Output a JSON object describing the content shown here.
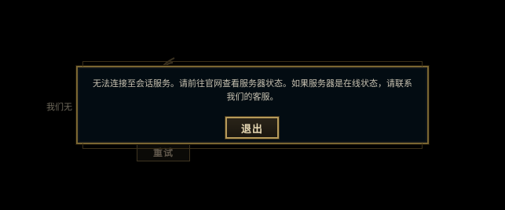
{
  "background": {
    "partial_text": "我们无",
    "retry_button_label": "重试"
  },
  "dialog": {
    "message": "无法连接至会话服务。请前往官网查看服务器状态。如果服务器是在线状态，请联系我们的客服。",
    "exit_button_label": "退出"
  },
  "colors": {
    "dialog_border": "#7a6632",
    "dialog_background": "#030c12",
    "button_border": "#b69a5a",
    "button_text": "#e8d9b4"
  }
}
